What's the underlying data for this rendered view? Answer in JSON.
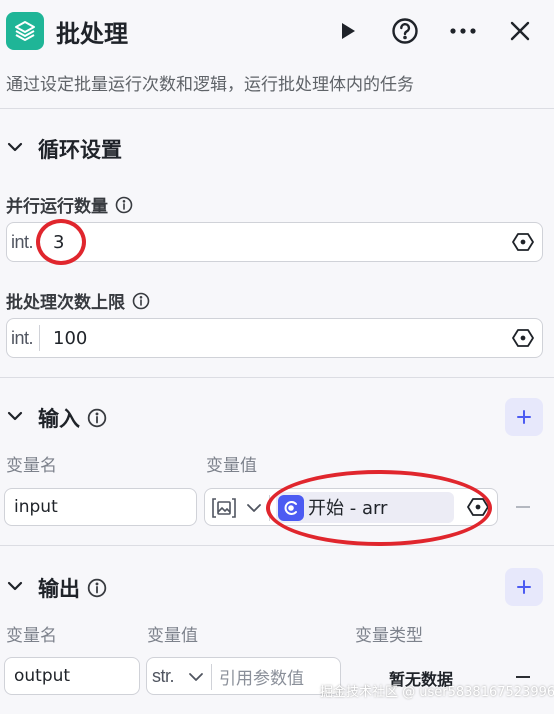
{
  "header": {
    "title": "批处理",
    "description": "通过设定批量运行次数和逻辑，运行批处理体内的任务"
  },
  "loop": {
    "section_title": "循环设置",
    "parallel": {
      "label": "并行运行数量",
      "type_tag": "int.",
      "value": "3"
    },
    "limit": {
      "label": "批处理次数上限",
      "type_tag": "int.",
      "value": "100"
    }
  },
  "inputs": {
    "section_title": "输入",
    "col_name": "变量名",
    "col_value": "变量值",
    "rows": [
      {
        "name": "input",
        "ref_text": "开始 - arr"
      }
    ]
  },
  "outputs": {
    "section_title": "输出",
    "col_name": "变量名",
    "col_value": "变量值",
    "col_type": "变量类型",
    "rows": [
      {
        "name": "output",
        "type_tag": "str.",
        "placeholder": "引用参数值",
        "type_value": "暂无数据"
      }
    ]
  },
  "watermark": "掘金技术社区 @ user5838167523996",
  "colors": {
    "brand": "#1fb597",
    "accent": "#4c5bf2",
    "annotation": "#e0262d"
  }
}
